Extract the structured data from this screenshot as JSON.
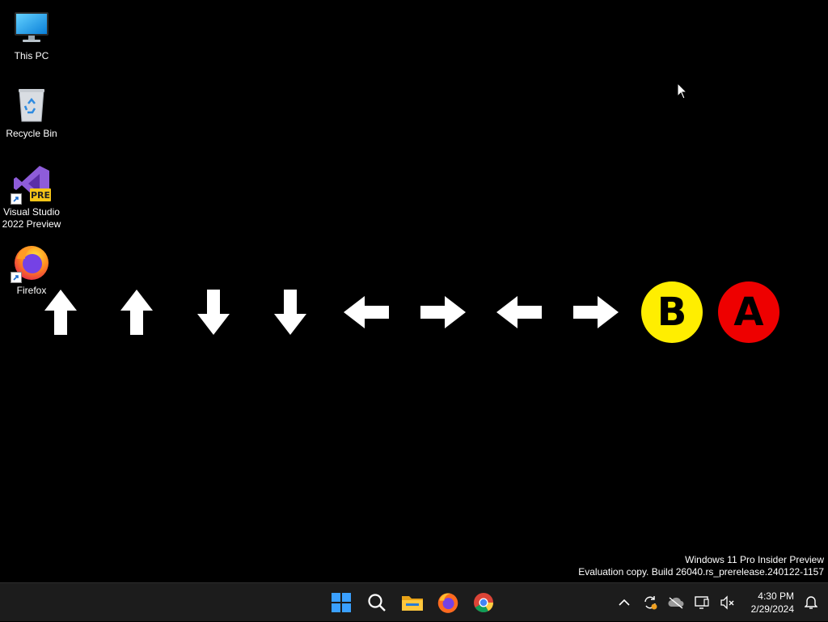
{
  "desktop": {
    "icons": [
      {
        "label": "This PC",
        "icon": "monitor-icon"
      },
      {
        "label": "Recycle Bin",
        "icon": "recycle-bin-icon"
      },
      {
        "label": "Visual Studio 2022 Preview",
        "icon": "visual-studio-icon",
        "badge": "PRE"
      },
      {
        "label": "Firefox",
        "icon": "firefox-icon"
      }
    ],
    "sequence": [
      {
        "type": "arrow",
        "direction": "up",
        "icon": "arrow-up-icon"
      },
      {
        "type": "arrow",
        "direction": "up",
        "icon": "arrow-up-icon"
      },
      {
        "type": "arrow",
        "direction": "down",
        "icon": "arrow-down-icon"
      },
      {
        "type": "arrow",
        "direction": "down",
        "icon": "arrow-down-icon"
      },
      {
        "type": "arrow",
        "direction": "left",
        "icon": "arrow-left-icon"
      },
      {
        "type": "arrow",
        "direction": "right",
        "icon": "arrow-right-icon"
      },
      {
        "type": "arrow",
        "direction": "left",
        "icon": "arrow-left-icon"
      },
      {
        "type": "arrow",
        "direction": "right",
        "icon": "arrow-right-icon"
      },
      {
        "type": "button",
        "letter": "B",
        "color": "#ffee00"
      },
      {
        "type": "button",
        "letter": "A",
        "color": "#ee0000"
      }
    ],
    "watermark": {
      "line1": "Windows 11 Pro Insider Preview",
      "line2": "Evaluation copy. Build 26040.rs_prerelease.240122-1157"
    }
  },
  "taskbar": {
    "pinned": [
      {
        "icon": "windows-start-icon"
      },
      {
        "icon": "search-icon"
      },
      {
        "icon": "file-explorer-icon"
      },
      {
        "icon": "firefox-icon"
      },
      {
        "icon": "chrome-icon"
      }
    ],
    "tray": [
      {
        "icon": "chevron-up-icon"
      },
      {
        "icon": "sync-icon"
      },
      {
        "icon": "onedrive-offline-icon"
      },
      {
        "icon": "network-icon"
      },
      {
        "icon": "volume-muted-icon"
      }
    ],
    "clock": {
      "time": "4:30 PM",
      "date": "2/29/2024"
    },
    "notification_icon": "bell-icon"
  },
  "colors": {
    "desktop_bg": "#000000",
    "taskbar_bg": "#1c1c1c",
    "b_button": "#ffee00",
    "a_button": "#ee0000",
    "windows_blue": "#3aa0ff"
  }
}
